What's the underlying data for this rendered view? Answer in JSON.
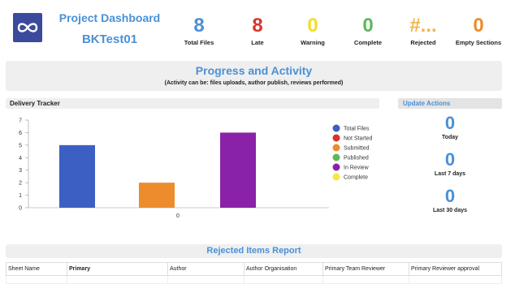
{
  "header": {
    "title": "Project Dashboard",
    "project_name": "BKTest01",
    "logo_icon": "infinity-icon"
  },
  "stats": [
    {
      "value": "8",
      "label": "Total Files",
      "color": "#4a90d6"
    },
    {
      "value": "8",
      "label": "Late",
      "color": "#d9342b"
    },
    {
      "value": "0",
      "label": "Warning",
      "color": "#f5dc28"
    },
    {
      "value": "0",
      "label": "Complete",
      "color": "#5cb85c"
    },
    {
      "value": "#...",
      "label": "Rejected",
      "color": "#f2b64c"
    },
    {
      "value": "0",
      "label": "Empty Sections",
      "color": "#ec8c2c"
    }
  ],
  "progress": {
    "title": "Progress and Activity",
    "subtitle": "(Activity can be: files uploads, author publish, reviews performed)"
  },
  "tracker": {
    "title": "Delivery Tracker"
  },
  "chart_data": {
    "type": "bar",
    "categories": [
      "0"
    ],
    "series": [
      {
        "name": "Total Files",
        "values": [
          5
        ],
        "color": "#3c5fc4"
      },
      {
        "name": "Not Started",
        "values": [
          0
        ],
        "color": "#d9342b"
      },
      {
        "name": "Submitted",
        "values": [
          2
        ],
        "color": "#ec8c2c"
      },
      {
        "name": "Published",
        "values": [
          0
        ],
        "color": "#5cb85c"
      },
      {
        "name": "In Review",
        "values": [
          6
        ],
        "color": "#8a22a8"
      },
      {
        "name": "Complete",
        "values": [
          0
        ],
        "color": "#f5e93c"
      }
    ],
    "ylim": [
      0,
      7
    ],
    "yticks": [
      "0",
      "1",
      "2",
      "3",
      "4",
      "5",
      "6",
      "7"
    ],
    "legend": "right",
    "grid": false
  },
  "update_actions": {
    "title": "Update Actions",
    "items": [
      {
        "value": "0",
        "label": "Today"
      },
      {
        "value": "0",
        "label": "Last 7 days"
      },
      {
        "value": "0",
        "label": "Last 30 days"
      }
    ]
  },
  "rejected": {
    "title": "Rejected Items Report",
    "columns": [
      "Sheet Name",
      "Primary",
      "Author",
      "Author Organisation",
      "Primary Team Reviewer",
      "Primary Reviewer approval"
    ]
  }
}
